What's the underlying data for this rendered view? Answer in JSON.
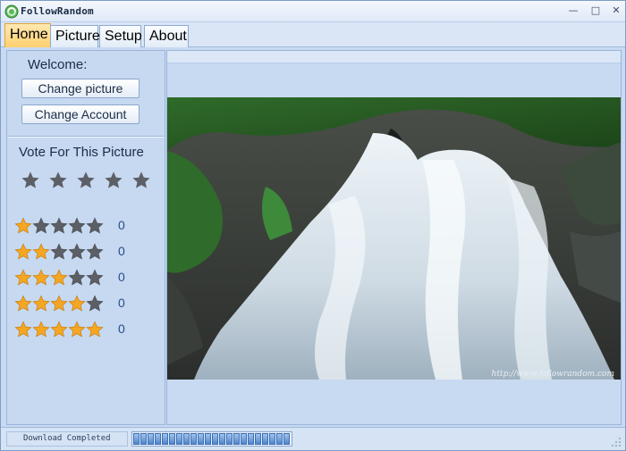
{
  "window": {
    "title": "FollowRandom"
  },
  "window_controls": {
    "minimize": "—",
    "maximize": "□",
    "close": "✕"
  },
  "tabs": [
    {
      "label": "Home",
      "active": true
    },
    {
      "label": "Picture",
      "active": false
    },
    {
      "label": "Setup",
      "active": false
    },
    {
      "label": "About",
      "active": false
    }
  ],
  "left": {
    "welcome": "Welcome:",
    "change_picture": "Change picture",
    "change_account": "Change Account",
    "vote_title": "Vote For This Picture",
    "vote_stars": 5,
    "ratings": [
      {
        "stars": 1,
        "count": "0"
      },
      {
        "stars": 2,
        "count": "0"
      },
      {
        "stars": 3,
        "count": "0"
      },
      {
        "stars": 4,
        "count": "0"
      },
      {
        "stars": 5,
        "count": "0"
      }
    ]
  },
  "picture": {
    "watermark": "http://www.followrandom.com"
  },
  "status": {
    "text": "Download Completed",
    "progress_percent": 100
  },
  "colors": {
    "star_gold": "#f5a623",
    "star_gray": "#5d5f66",
    "accent_tab": "#ffcf6e"
  }
}
